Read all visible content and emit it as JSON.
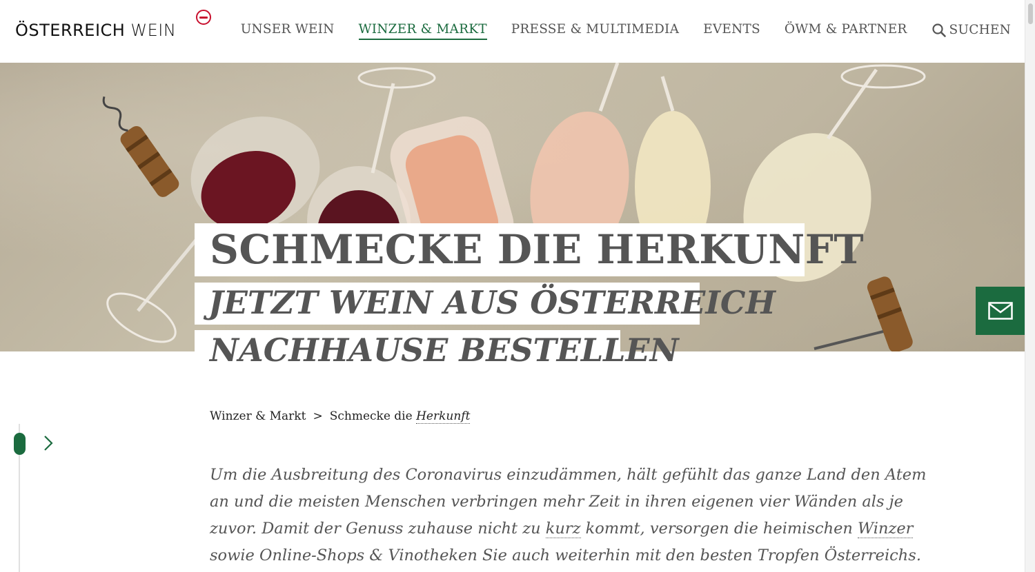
{
  "header": {
    "logo_main": "ÖSTERREICH",
    "logo_sub": "WEIN",
    "nav": [
      {
        "label": "UNSER WEIN",
        "active": false
      },
      {
        "label": "WINZER & MARKT",
        "active": true
      },
      {
        "label": "PRESSE & MULTIMEDIA",
        "active": false
      },
      {
        "label": "EVENTS",
        "active": false
      },
      {
        "label": "ÖWM & PARTNER",
        "active": false
      }
    ],
    "search_label": "SUCHEN"
  },
  "hero": {
    "title": "SCHMECKE DIE HERKUNFT",
    "subtitle_line1": "JETZT WEIN AUS ÖSTERREICH",
    "subtitle_line2": "NACHHAUSE BESTELLEN",
    "mail_icon": "mail-icon"
  },
  "breadcrumb": {
    "parent": "Winzer & Markt",
    "separator": ">",
    "current_prefix": "Schmecke die ",
    "current_em": "Herkunft"
  },
  "intro": {
    "part1": "Um die Ausbreitung des Coronavirus einzudämmen, hält gefühlt das ganze Land den Atem an und die meisten Menschen verbringen mehr Zeit in ihren eigenen vier Wänden als je zuvor. Damit der Genuss zuhause nicht zu ",
    "link1": "kurz",
    "part2": " kommt, versorgen die heimischen ",
    "link2": "Winzer",
    "part3": " sowie Online-Shops & Vinotheken Sie auch weiterhin mit den besten Tropfen Österreichs."
  },
  "colors": {
    "brand_green": "#1b6b3f",
    "brand_red": "#c8102e",
    "text_gray": "#555555"
  }
}
